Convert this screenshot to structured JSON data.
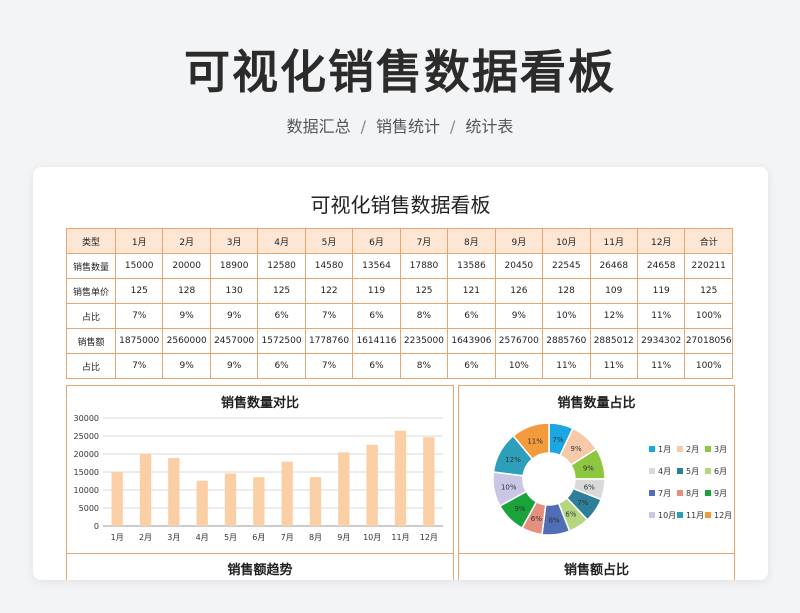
{
  "header": {
    "title": "可视化销售数据看板"
  },
  "breadcrumb": [
    "数据汇总",
    "/",
    "销售统计",
    "/",
    "统计表"
  ],
  "sheet": {
    "title": "可视化销售数据看板",
    "columns": [
      "类型",
      "1月",
      "2月",
      "3月",
      "4月",
      "5月",
      "6月",
      "7月",
      "8月",
      "9月",
      "10月",
      "11月",
      "12月",
      "合计"
    ],
    "rows": [
      [
        "销售数量",
        "15000",
        "20000",
        "18900",
        "12580",
        "14580",
        "13564",
        "17880",
        "13586",
        "20450",
        "22545",
        "26468",
        "24658",
        "220211"
      ],
      [
        "销售单价",
        "125",
        "128",
        "130",
        "125",
        "122",
        "119",
        "125",
        "121",
        "126",
        "128",
        "109",
        "119",
        "125"
      ],
      [
        "占比",
        "7%",
        "9%",
        "9%",
        "6%",
        "7%",
        "6%",
        "8%",
        "6%",
        "9%",
        "10%",
        "12%",
        "11%",
        "100%"
      ],
      [
        "销售额",
        "1875000",
        "2560000",
        "2457000",
        "1572500",
        "1778760",
        "1614116",
        "2235000",
        "1643906",
        "2576700",
        "2885760",
        "2885012",
        "2934302",
        "27018056"
      ],
      [
        "占比",
        "7%",
        "9%",
        "9%",
        "6%",
        "7%",
        "6%",
        "8%",
        "6%",
        "10%",
        "11%",
        "11%",
        "11%",
        "100%"
      ]
    ]
  },
  "panels": {
    "bar_title": "销售数量对比",
    "pie_title": "销售数量占比",
    "trend_title": "销售额趋势",
    "share_title": "销售额占比"
  },
  "chart_data": [
    {
      "type": "bar",
      "title": "销售数量对比",
      "categories": [
        "1月",
        "2月",
        "3月",
        "4月",
        "5月",
        "6月",
        "7月",
        "8月",
        "9月",
        "10月",
        "11月",
        "12月"
      ],
      "values": [
        15000,
        20000,
        18900,
        12580,
        14580,
        13564,
        17880,
        13586,
        20450,
        22545,
        26468,
        24658
      ],
      "ylim": [
        0,
        30000
      ],
      "yticks": [
        0,
        5000,
        10000,
        15000,
        20000,
        25000,
        30000
      ],
      "grid": true,
      "color": "#fbcfa5"
    },
    {
      "type": "pie",
      "title": "销售数量占比",
      "categories": [
        "1月",
        "2月",
        "3月",
        "4月",
        "5月",
        "6月",
        "7月",
        "8月",
        "9月",
        "10月",
        "11月",
        "12月"
      ],
      "values": [
        7,
        9,
        9,
        6,
        7,
        6,
        8,
        6,
        9,
        10,
        12,
        11
      ],
      "labels": [
        "7%",
        "9%",
        "9%",
        "6%",
        "7%",
        "6%",
        "8%",
        "6%",
        "9%",
        "10%",
        "12%",
        "11%"
      ],
      "colors": [
        "#1aa6e0",
        "#f6c9a8",
        "#8dc63f",
        "#d9d9d9",
        "#2d7f99",
        "#b6d57f",
        "#4f6eb5",
        "#e58f7f",
        "#1aa33b",
        "#c9c6e6",
        "#2e9fba",
        "#f39a3c"
      ],
      "legend": "right"
    }
  ]
}
